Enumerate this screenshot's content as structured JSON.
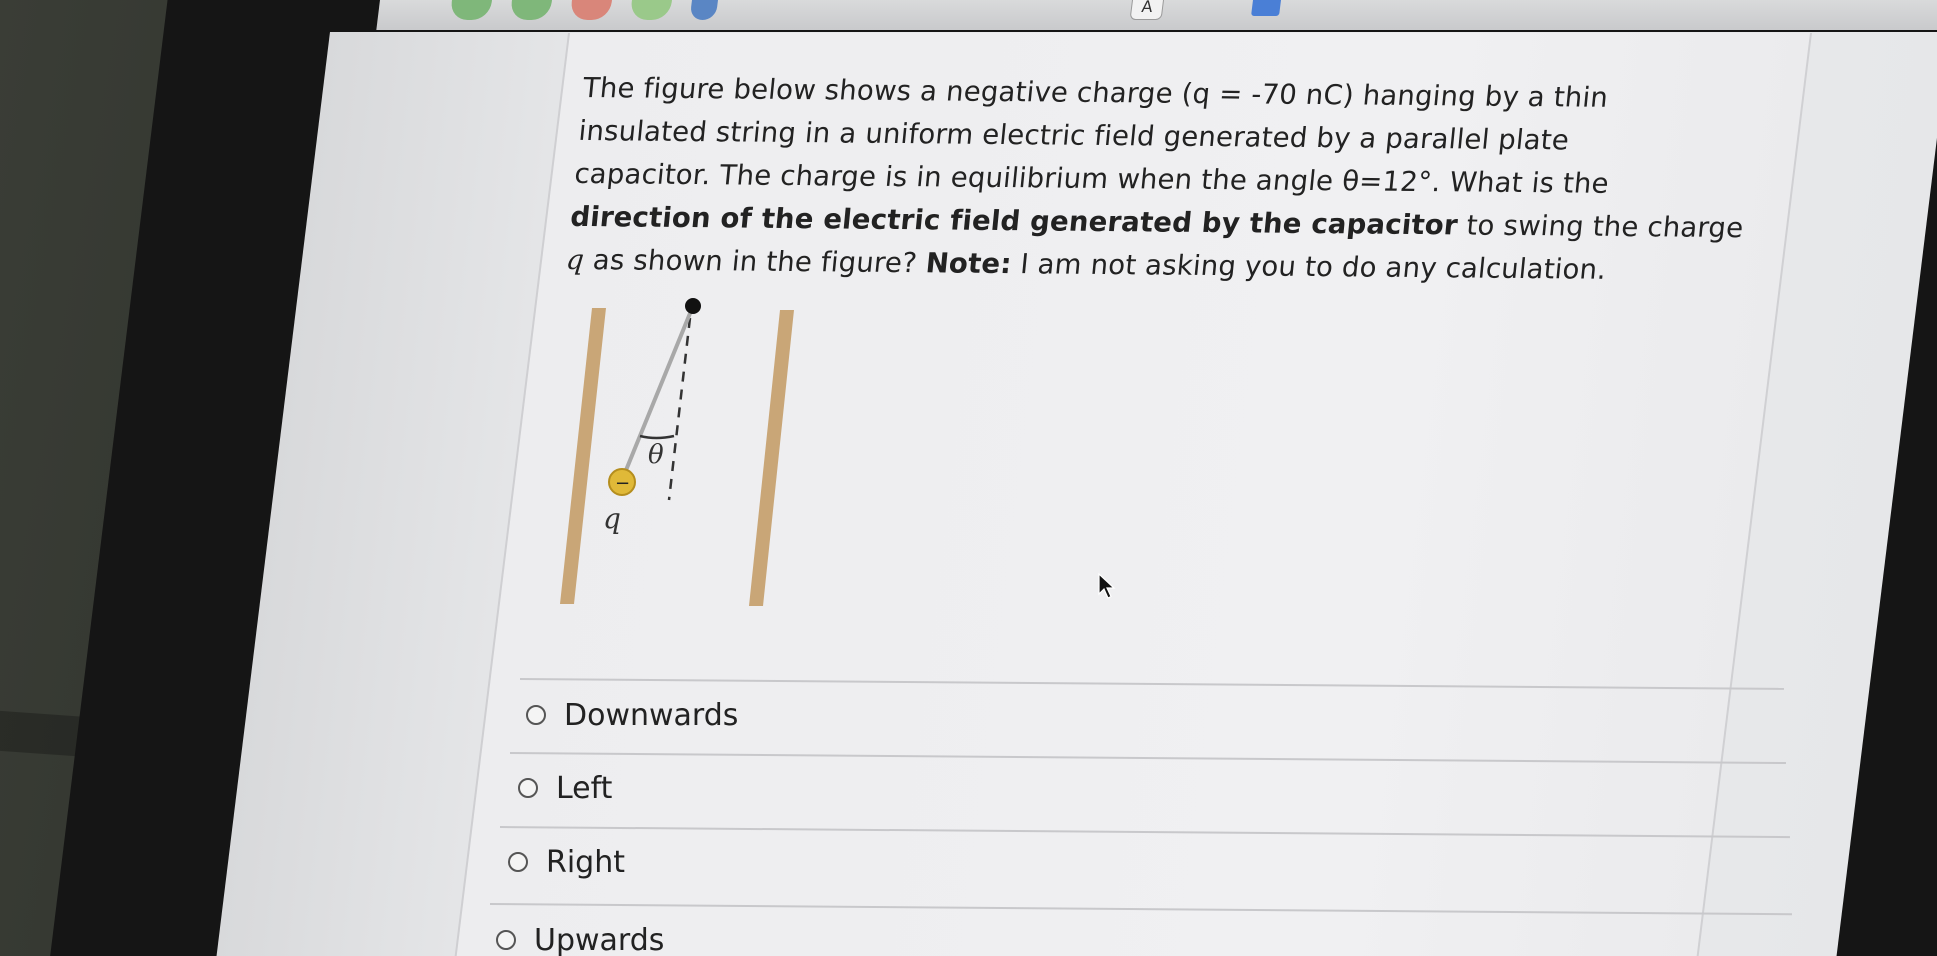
{
  "question": {
    "line1": "The figure below shows a negative charge (q = -70 nC) hanging by a thin",
    "line2": "insulated string in a uniform electric field generated by a parallel plate",
    "line3": "capacitor. The charge is in equilibrium when the angle θ=12°. What is the",
    "line4_bold": "direction of the electric field generated by the capacitor",
    "line4_rest": " to swing the charge",
    "line5_var": "q",
    "line5_mid": " as shown in the figure? ",
    "line5_note_label": "Note:",
    "line5_note": " I am not asking you to do any calculation."
  },
  "figure": {
    "angle_label": "θ",
    "charge_sign": "−",
    "charge_label": "q"
  },
  "options": [
    {
      "label": "Downwards"
    },
    {
      "label": "Left"
    },
    {
      "label": "Right"
    },
    {
      "label": "Upwards"
    }
  ],
  "toolbar": {
    "font_button_label": "A",
    "icons": [
      "back-icon",
      "forward-icon",
      "stop-icon",
      "reload-icon",
      "home-icon",
      "font-icon",
      "grid-icon"
    ]
  },
  "colors": {
    "plate": "#c9a677",
    "charge": "#e0b938",
    "text": "#222222"
  }
}
